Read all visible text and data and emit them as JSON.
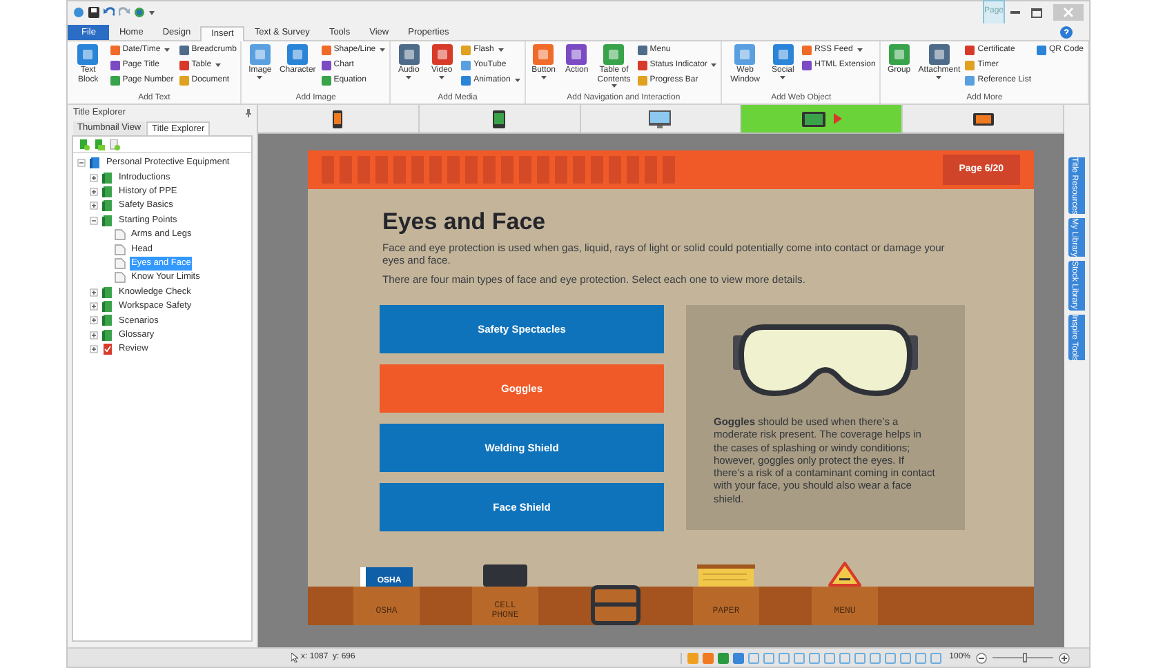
{
  "window": {
    "context_tab": "Page"
  },
  "tabs": [
    {
      "label": "File",
      "kind": "file",
      "selected": false
    },
    {
      "label": "Home",
      "kind": "tab",
      "selected": false
    },
    {
      "label": "Design",
      "kind": "tab",
      "selected": false
    },
    {
      "label": "Insert",
      "kind": "tab",
      "selected": true
    },
    {
      "label": "Text & Survey",
      "kind": "tab",
      "selected": false
    },
    {
      "label": "Tools",
      "kind": "tab",
      "selected": false
    },
    {
      "label": "View",
      "kind": "tab",
      "selected": false
    },
    {
      "label": "Properties",
      "kind": "tab",
      "selected": false
    }
  ],
  "ribbon": [
    {
      "label": "Add Text",
      "items": [
        {
          "label": "Text Block",
          "kind": "large",
          "dropdown": false
        },
        {
          "label": "Date/Time",
          "kind": "small",
          "dropdown": true
        },
        {
          "label": "Page Title",
          "kind": "small",
          "dropdown": false
        },
        {
          "label": "Page Number",
          "kind": "small",
          "dropdown": false
        },
        {
          "label": "Breadcrumb",
          "kind": "small",
          "dropdown": false
        },
        {
          "label": "Table",
          "kind": "small",
          "dropdown": true
        },
        {
          "label": "Document",
          "kind": "small",
          "dropdown": false
        }
      ]
    },
    {
      "label": "Add Image",
      "items": [
        {
          "label": "Image",
          "kind": "large",
          "dropdown": true
        },
        {
          "label": "Character",
          "kind": "large",
          "dropdown": false
        },
        {
          "label": "Shape/Line",
          "kind": "small",
          "dropdown": true
        },
        {
          "label": "Chart",
          "kind": "small",
          "dropdown": false
        },
        {
          "label": "Equation",
          "kind": "small",
          "dropdown": false
        }
      ]
    },
    {
      "label": "Add Media",
      "items": [
        {
          "label": "Audio",
          "kind": "large",
          "dropdown": true
        },
        {
          "label": "Video",
          "kind": "large",
          "dropdown": true
        },
        {
          "label": "Flash",
          "kind": "small",
          "dropdown": true
        },
        {
          "label": "YouTube",
          "kind": "small",
          "dropdown": false
        },
        {
          "label": "Animation",
          "kind": "small",
          "dropdown": true
        }
      ]
    },
    {
      "label": "Add Navigation and Interaction",
      "items": [
        {
          "label": "Button",
          "kind": "large",
          "dropdown": true
        },
        {
          "label": "Action",
          "kind": "large",
          "dropdown": false
        },
        {
          "label": "Table of Contents",
          "kind": "large",
          "dropdown": true
        },
        {
          "label": "Menu",
          "kind": "small",
          "dropdown": false
        },
        {
          "label": "Status Indicator",
          "kind": "small",
          "dropdown": true
        },
        {
          "label": "Progress Bar",
          "kind": "small",
          "dropdown": false
        }
      ]
    },
    {
      "label": "Add Web Object",
      "items": [
        {
          "label": "Web Window",
          "kind": "large",
          "dropdown": false
        },
        {
          "label": "Social",
          "kind": "large",
          "dropdown": true
        },
        {
          "label": "RSS Feed",
          "kind": "small",
          "dropdown": true
        },
        {
          "label": "HTML Extension",
          "kind": "small",
          "dropdown": false
        }
      ]
    },
    {
      "label": "Add More",
      "items": [
        {
          "label": "Group",
          "kind": "large",
          "dropdown": false
        },
        {
          "label": "Attachment",
          "kind": "large",
          "dropdown": true
        },
        {
          "label": "Certificate",
          "kind": "small",
          "dropdown": false
        },
        {
          "label": "Timer",
          "kind": "small",
          "dropdown": false
        },
        {
          "label": "Reference List",
          "kind": "small",
          "dropdown": false
        },
        {
          "label": "QR Code",
          "kind": "small",
          "dropdown": false
        }
      ]
    }
  ],
  "explorer": {
    "title": "Title Explorer",
    "tabs": [
      {
        "label": "Thumbnail View",
        "selected": false
      },
      {
        "label": "Title Explorer",
        "selected": true
      }
    ],
    "tree": [
      {
        "label": "Personal Protective Equipment",
        "kind": "title",
        "expanded": true,
        "selected": false,
        "children": [
          {
            "label": "Introductions",
            "kind": "chapter",
            "expanded": false,
            "selected": false
          },
          {
            "label": "History of PPE",
            "kind": "chapter",
            "expanded": false,
            "selected": false
          },
          {
            "label": "Safety Basics",
            "kind": "chapter",
            "expanded": false,
            "selected": false
          },
          {
            "label": "Starting Points",
            "kind": "chapter",
            "expanded": true,
            "selected": false,
            "children": [
              {
                "label": "Arms and Legs",
                "kind": "page",
                "selected": false
              },
              {
                "label": "Head",
                "kind": "page",
                "selected": false
              },
              {
                "label": "Eyes and Face",
                "kind": "page",
                "selected": true
              },
              {
                "label": "Know Your Limits",
                "kind": "page",
                "selected": false
              }
            ]
          },
          {
            "label": "Knowledge Check",
            "kind": "chapter",
            "expanded": false,
            "selected": false
          },
          {
            "label": "Workspace Safety",
            "kind": "chapter",
            "expanded": false,
            "selected": false
          },
          {
            "label": "Scenarios",
            "kind": "chapter",
            "expanded": false,
            "selected": false
          },
          {
            "label": "Glossary",
            "kind": "chapter",
            "expanded": false,
            "selected": false
          },
          {
            "label": "Review",
            "kind": "test",
            "expanded": false,
            "selected": false
          }
        ]
      }
    ]
  },
  "devices": [
    {
      "kind": "phone",
      "selected": false
    },
    {
      "kind": "phone-portrait",
      "selected": false
    },
    {
      "kind": "desktop",
      "selected": false
    },
    {
      "kind": "tablet",
      "selected": true
    },
    {
      "kind": "tablet-landscape",
      "selected": false
    }
  ],
  "slide": {
    "page": "Page 6/20",
    "title": "Eyes and Face",
    "paragraphs": [
      "Face and eye protection is used when gas, liquid, rays of light or solid could potentially come into contact or damage your eyes and face.",
      "There are four main types of face and eye protection. Select each one to view more details."
    ],
    "options": [
      {
        "label": "Safety Spectacles",
        "selected": false
      },
      {
        "label": "Goggles",
        "selected": true
      },
      {
        "label": "Welding Shield",
        "selected": false
      },
      {
        "label": "Face Shield",
        "selected": false
      }
    ],
    "detail": "**Goggles** should be used when there’s a moderate risk present. The coverage helps in the cases of splashing or windy conditions; however, goggles only protect the eyes. If there’s a risk of a contaminant coming in contact with your face, you should also wear a face shield.",
    "notebook_label": "OSHA",
    "pockets": [
      {
        "label": "OSHA",
        "kind": "notebook"
      },
      {
        "label": "CELL PHONE",
        "kind": "phone"
      },
      {
        "kind": "buckle"
      },
      {
        "label": "PAPER",
        "kind": "paper"
      },
      {
        "label": "MENU",
        "kind": "sign"
      }
    ]
  },
  "side_tabs": [
    "Title Resources",
    "My Library",
    "Stock Library",
    "Inspire Tools"
  ],
  "status_bar": {
    "coords": "x: 1087  y: 696",
    "zoom": "100%",
    "zoom_slider": {
      "level": 0.5
    }
  }
}
